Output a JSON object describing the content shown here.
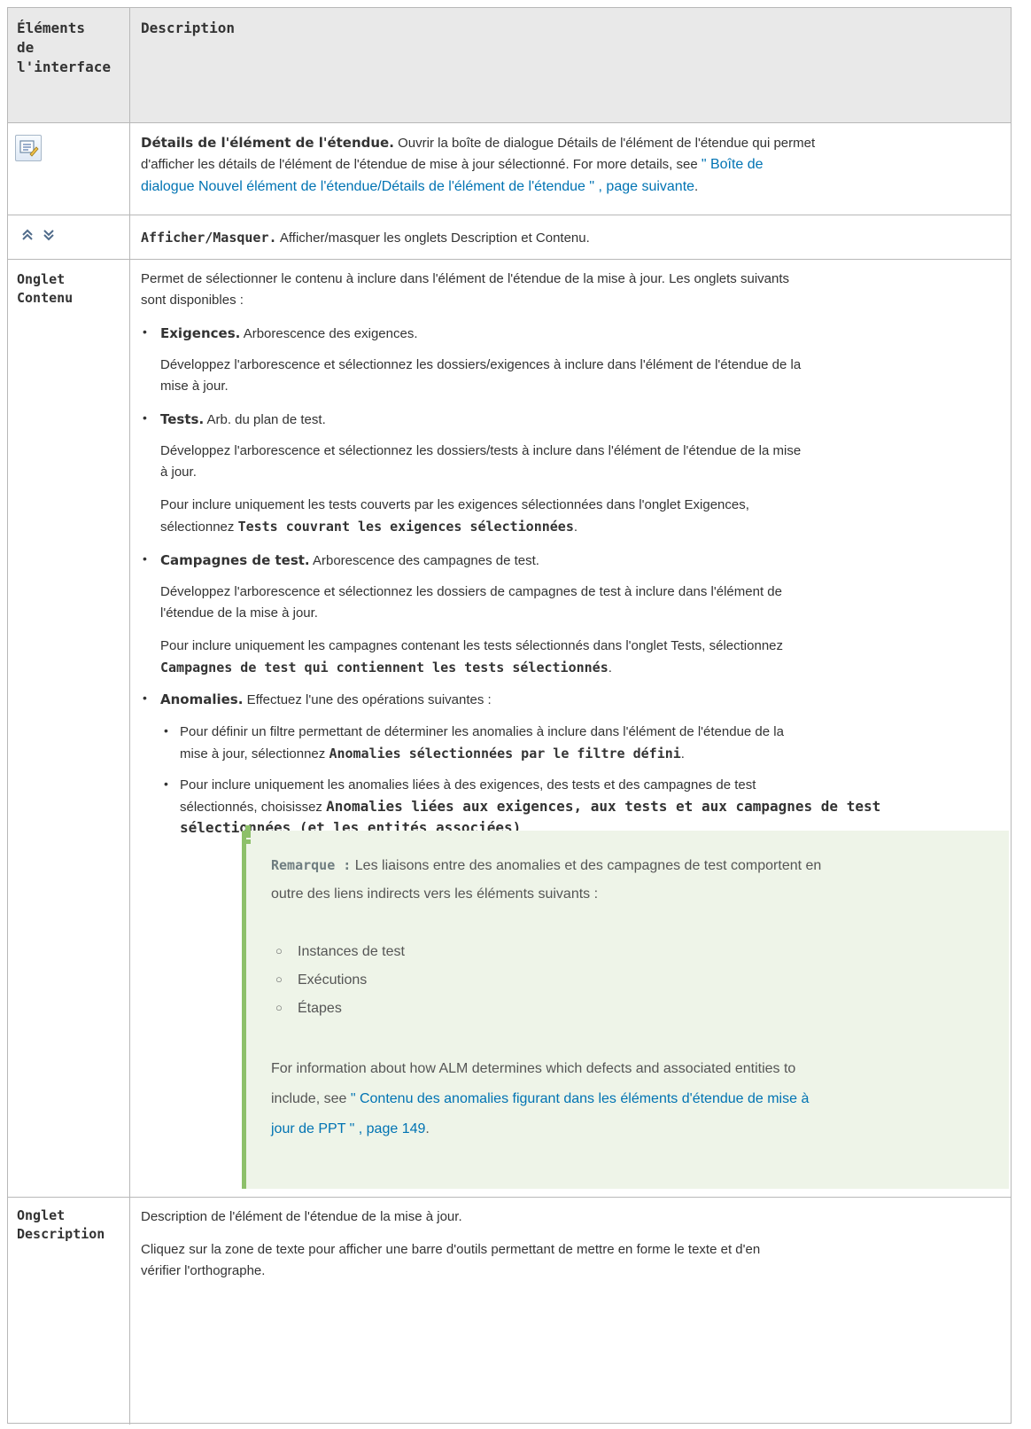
{
  "header": {
    "col1_l1": "Éléments",
    "col1_l2": "de",
    "col1_l3": "l'interface",
    "col2": "Description"
  },
  "rows": {
    "details": {
      "icon": "edit-details-icon",
      "title": "Détails de l'élément de l'étendue.",
      "l1": "Ouvrir la boîte de dialogue Détails de l'élément de l'étendue qui permet",
      "l2": "d'afficher les détails de l'élément de l'étendue de mise à jour sélectionné. For more details, see",
      "link1": "\" Boîte de",
      "link2": "dialogue Nouvel élément de l'étendue/Détails de l'élément de l'étendue \" , page suivante",
      "end": "."
    },
    "toggle": {
      "icons": [
        "double-chevron-up-icon",
        "double-chevron-down-icon"
      ],
      "title": "Afficher/Masquer.",
      "text": "Afficher/masquer les onglets Description et Contenu."
    },
    "content": {
      "label_l1": "Onglet",
      "label_l2": "Contenu",
      "intro1": "Permet de sélectionner le contenu à inclure dans l'élément de l'étendue de la mise à jour. Les onglets suivants",
      "intro2": "sont disponibles :",
      "req_title": "Exigences.",
      "req_text": "Arborescence des exigences.",
      "req_p1": "Développez l'arborescence et sélectionnez les dossiers/exigences à inclure dans l'élément de l'étendue de la",
      "req_p2": "mise à jour.",
      "tests_title": "Tests.",
      "tests_text": "Arb. du plan de test.",
      "tests_p1": "Développez l'arborescence et sélectionnez les dossiers/tests à inclure dans l'élément de l'étendue de la mise",
      "tests_p2": "à jour.",
      "tests_p3": "Pour inclure uniquement les tests couverts par les exigences sélectionnées dans l'onglet Exigences,",
      "tests_p4a": "sélectionnez",
      "tests_p4b": "Tests couvrant les exigences sélectionnées",
      "tests_p4c": ".",
      "camp_title": "Campagnes de test.",
      "camp_text": "Arborescence des campagnes de test.",
      "camp_p1": "Développez l'arborescence et sélectionnez les dossiers de campagnes de test à inclure dans l'élément de",
      "camp_p2": "l'étendue de la mise à jour.",
      "camp_p3": "Pour inclure uniquement les campagnes contenant les tests sélectionnés dans l'onglet Tests, sélectionnez",
      "camp_p4a": "Campagnes de test qui contiennent les tests sélectionnés",
      "camp_p4b": ".",
      "anom_title": "Anomalies.",
      "anom_text": "Effectuez l'une des opérations suivantes :",
      "anom_s1a": "Pour définir un filtre permettant de déterminer les anomalies à inclure dans l'élément de l'étendue de la",
      "anom_s1b": "mise à jour, sélectionnez",
      "anom_s1c": "Anomalies sélectionnées par le filtre défini",
      "anom_s1d": ".",
      "anom_s2a": "Pour inclure uniquement les anomalies liées à des exigences, des tests et des campagnes de test",
      "anom_s2b": "sélectionnés, choisissez",
      "anom_s2c": "Anomalies liées aux exigences, aux tests et aux campagnes de test",
      "anom_s2d": "sélectionnées (et les entités associées)",
      "anom_s2e": ".",
      "note": {
        "icon": "exclamation-icon",
        "label": "Remarque :",
        "l1": "Les liaisons entre des anomalies et des campagnes de test comportent en",
        "l2": "outre des liens indirects vers les éléments suivants :",
        "items": [
          "Instances de test",
          "Exécutions",
          "Étapes"
        ],
        "f1": "For information about how ALM determines which defects and associated entities to",
        "f2a": "include, see",
        "link1": "\" Contenu des anomalies figurant dans les éléments d'étendue de mise à",
        "link2": "jour de PPT \" , page 149",
        "f2b": "."
      }
    },
    "description": {
      "label_l1": "Onglet",
      "label_l2": "Description",
      "l1": "Description de l'élément de l'étendue de la mise à jour.",
      "l2": "Cliquez sur la zone de texte pour afficher une barre d'outils permettant de mettre en forme le texte et d'en",
      "l3": "vérifier l'orthographe."
    }
  }
}
